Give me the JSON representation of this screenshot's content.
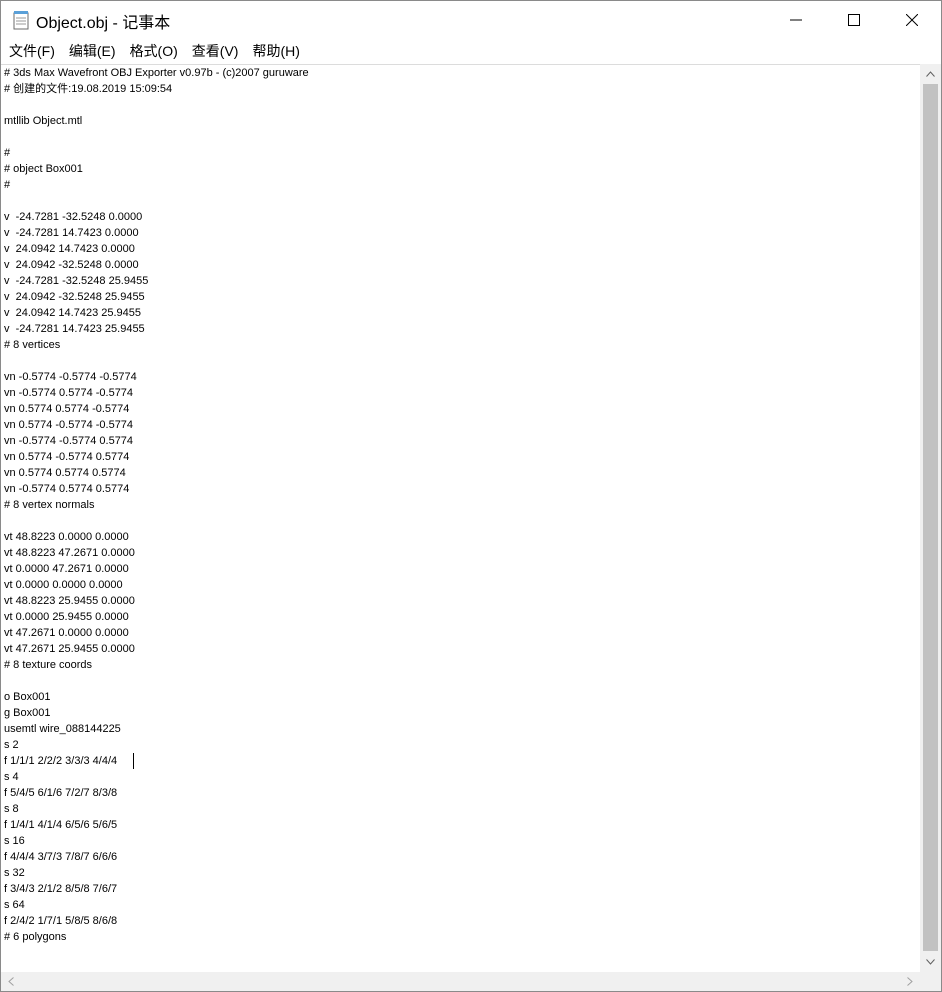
{
  "window": {
    "title": "Object.obj - 记事本",
    "icon": "notepad-icon"
  },
  "menu": [
    {
      "label": "文件(F)"
    },
    {
      "label": "编辑(E)"
    },
    {
      "label": "格式(O)"
    },
    {
      "label": "查看(V)"
    },
    {
      "label": "帮助(H)"
    }
  ],
  "editor": {
    "content": "# 3ds Max Wavefront OBJ Exporter v0.97b - (c)2007 guruware\n# 创建的文件:19.08.2019 15:09:54\n\nmtllib Object.mtl\n\n#\n# object Box001\n#\n\nv  -24.7281 -32.5248 0.0000\nv  -24.7281 14.7423 0.0000\nv  24.0942 14.7423 0.0000\nv  24.0942 -32.5248 0.0000\nv  -24.7281 -32.5248 25.9455\nv  24.0942 -32.5248 25.9455\nv  24.0942 14.7423 25.9455\nv  -24.7281 14.7423 25.9455\n# 8 vertices\n\nvn -0.5774 -0.5774 -0.5774\nvn -0.5774 0.5774 -0.5774\nvn 0.5774 0.5774 -0.5774\nvn 0.5774 -0.5774 -0.5774\nvn -0.5774 -0.5774 0.5774\nvn 0.5774 -0.5774 0.5774\nvn 0.5774 0.5774 0.5774\nvn -0.5774 0.5774 0.5774\n# 8 vertex normals\n\nvt 48.8223 0.0000 0.0000\nvt 48.8223 47.2671 0.0000\nvt 0.0000 47.2671 0.0000\nvt 0.0000 0.0000 0.0000\nvt 48.8223 25.9455 0.0000\nvt 0.0000 25.9455 0.0000\nvt 47.2671 0.0000 0.0000\nvt 47.2671 25.9455 0.0000\n# 8 texture coords\n\no Box001\ng Box001\nusemtl wire_088144225\ns 2\nf 1/1/1 2/2/2 3/3/3 4/4/4\ns 4\nf 5/4/5 6/1/6 7/2/7 8/3/8\ns 8\nf 1/4/1 4/1/4 6/5/6 5/6/5\ns 16\nf 4/4/4 3/7/3 7/8/7 6/6/6\ns 32\nf 3/4/3 2/1/2 8/5/8 7/6/7\ns 64\nf 2/4/2 1/7/1 5/8/5 8/6/8\n# 6 polygons"
  },
  "colors": {
    "scrollbar_track": "#f0f0f0",
    "scrollbar_thumb": "#c2c2c2",
    "text": "#000000"
  }
}
